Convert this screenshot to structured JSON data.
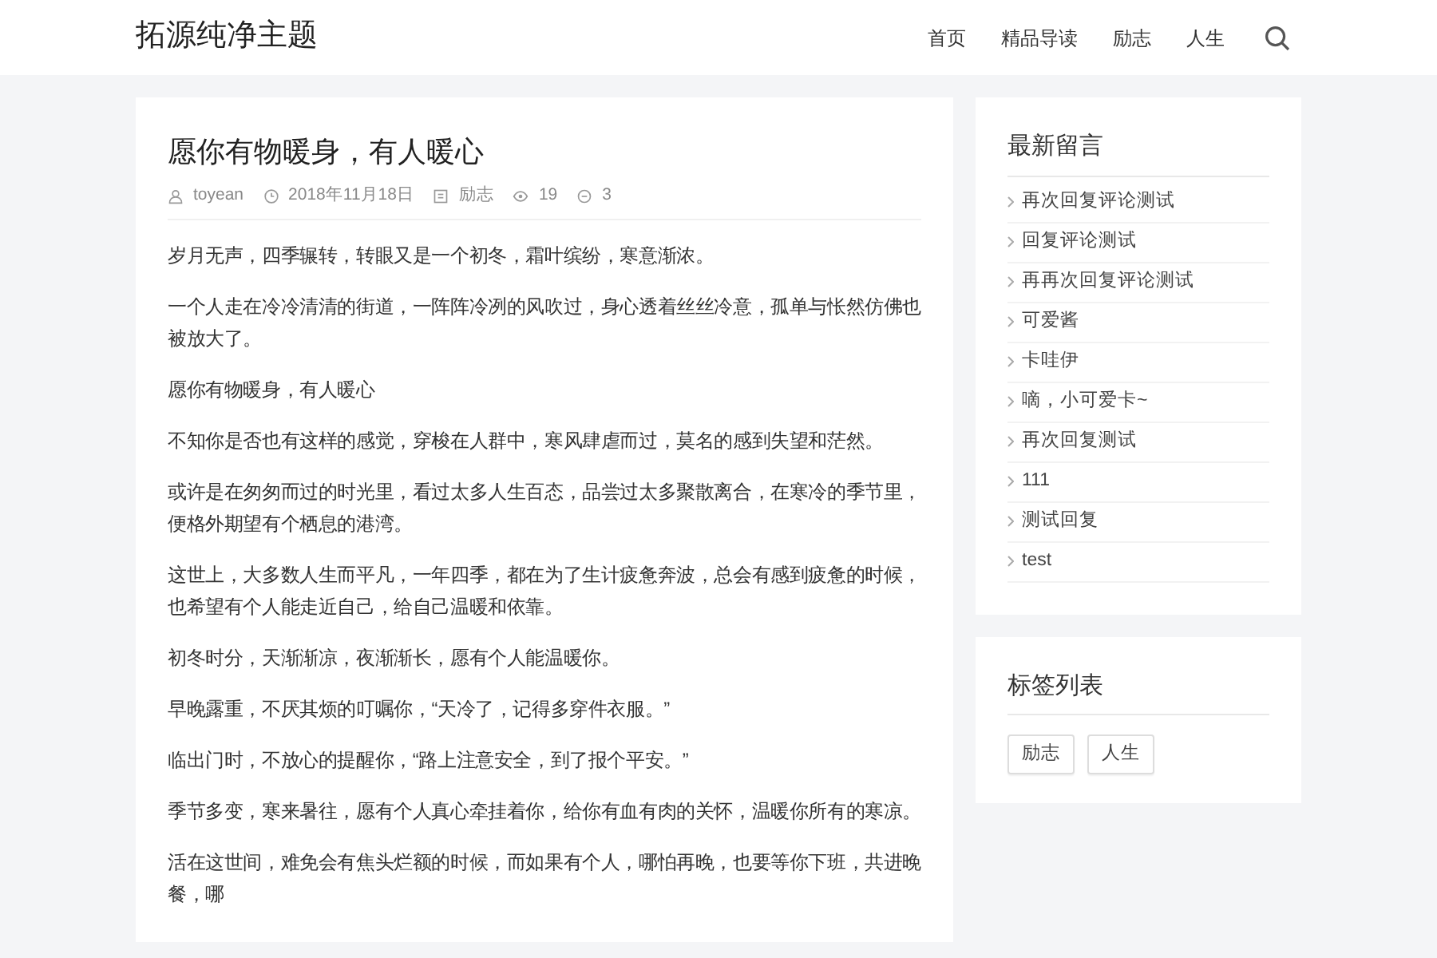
{
  "header": {
    "site_title": "拓源纯净主题",
    "nav": [
      {
        "label": "首页"
      },
      {
        "label": "精品导读"
      },
      {
        "label": "励志"
      },
      {
        "label": "人生"
      }
    ]
  },
  "article": {
    "title": "愿你有物暖身，有人暖心",
    "meta": [
      {
        "kind": "author",
        "text": "toyean"
      },
      {
        "kind": "date",
        "text": "2018年11月18日"
      },
      {
        "kind": "category",
        "text": "励志"
      },
      {
        "kind": "views",
        "text": "19"
      },
      {
        "kind": "comments",
        "text": "3"
      }
    ],
    "paragraphs": [
      "岁月无声，四季辗转，转眼又是一个初冬，霜叶缤纷，寒意渐浓。",
      "一个人走在冷冷清清的街道，一阵阵冷冽的风吹过，身心透着丝丝冷意，孤单与怅然仿佛也被放大了。",
      "愿你有物暖身，有人暖心",
      "不知你是否也有这样的感觉，穿梭在人群中，寒风肆虐而过，莫名的感到失望和茫然。",
      "或许是在匆匆而过的时光里，看过太多人生百态，品尝过太多聚散离合，在寒冷的季节里，便格外期望有个栖息的港湾。",
      "这世上，大多数人生而平凡，一年四季，都在为了生计疲惫奔波，总会有感到疲惫的时候，也希望有个人能走近自己，给自己温暖和依靠。",
      "初冬时分，天渐渐凉，夜渐渐长，愿有个人能温暖你。",
      "早晚露重，不厌其烦的叮嘱你，“天冷了，记得多穿件衣服。”",
      "临出门时，不放心的提醒你，“路上注意安全，到了报个平安。”",
      "季节多变，寒来暑往，愿有个人真心牵挂着你，给你有血有肉的关怀，温暖你所有的寒凉。",
      "活在这世间，难免会有焦头烂额的时候，而如果有个人，哪怕再晚，也要等你下班，共进晚餐，哪"
    ]
  },
  "sidebar": {
    "comments": {
      "title": "最新留言",
      "items": [
        {
          "text": "再次回复评论测试"
        },
        {
          "text": "回复评论测试"
        },
        {
          "text": "再再次回复评论测试"
        },
        {
          "text": "可爱酱"
        },
        {
          "text": "卡哇伊"
        },
        {
          "text": "嘀，小可爱卡~"
        },
        {
          "text": "再次回复测试"
        },
        {
          "text": "111"
        },
        {
          "text": "测试回复"
        },
        {
          "text": "test"
        }
      ]
    },
    "tags": {
      "title": "标签列表",
      "items": [
        {
          "text": "励志"
        },
        {
          "text": "人生"
        }
      ]
    }
  }
}
